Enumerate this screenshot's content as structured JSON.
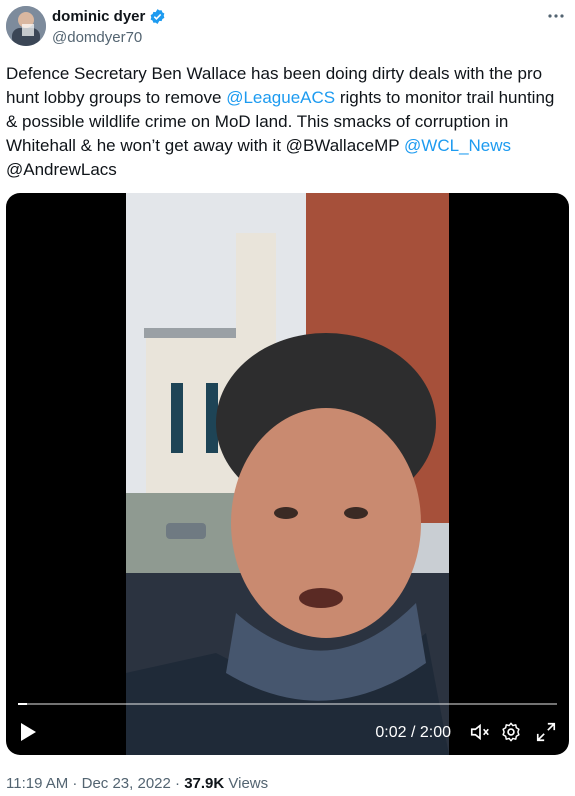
{
  "author": {
    "display_name": "dominic dyer",
    "handle": "@domdyer70",
    "verified": true
  },
  "tweet": {
    "text_parts": [
      {
        "t": "Defence Secretary Ben Wallace has been doing dirty deals with the pro hunt lobby groups to remove "
      },
      {
        "t": "@LeagueACS",
        "link": true
      },
      {
        "t": " rights to monitor trail hunting & possible wildlife crime on MoD land. This smacks of corruption in Whitehall & he won’t get away with it @BWallaceMP "
      },
      {
        "t": "@WCL_News",
        "link": true
      },
      {
        "t": " @AndrewLacs"
      }
    ]
  },
  "video": {
    "current_time": "0:02",
    "separator": " / ",
    "duration": "2:00",
    "progress": 0.017
  },
  "meta": {
    "time": "11:19 AM",
    "dot": " · ",
    "date": "Dec 23, 2022",
    "views_count": "37.9K",
    "views_label": "Views"
  },
  "colors": {
    "accent": "#1d9bf0",
    "text": "#0f1419",
    "muted": "#536471"
  },
  "icons": [
    "verified-badge-icon",
    "more-icon",
    "play-icon",
    "mute-icon",
    "settings-icon",
    "fullscreen-icon"
  ]
}
